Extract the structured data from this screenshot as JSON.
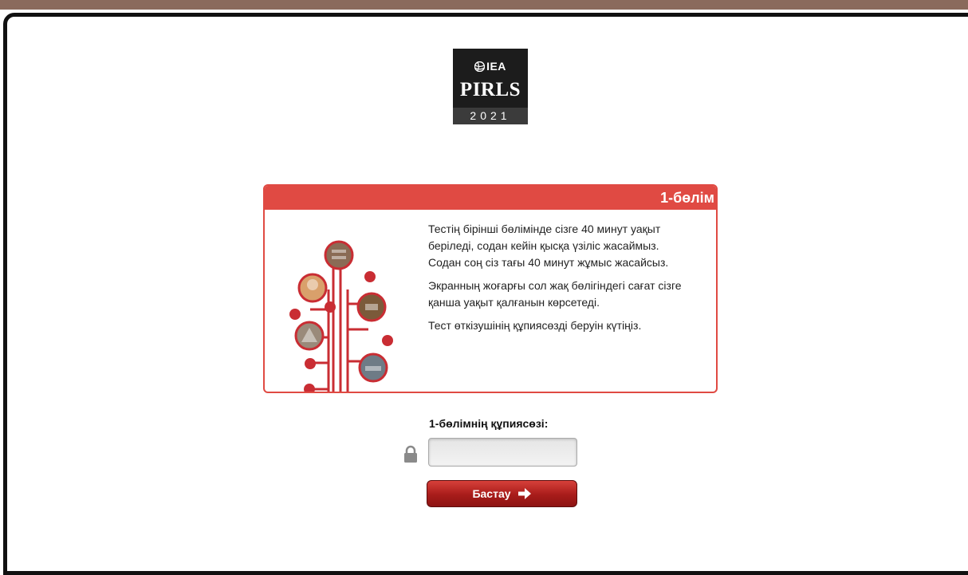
{
  "logo": {
    "org": "IEA",
    "name": "PIRLS",
    "year": "2021"
  },
  "section_card": {
    "header": "1-бөлім",
    "paragraphs": [
      "Тестің бірінші бөлімінде сізге 40 минут уақыт беріледі, содан кейін қысқа үзіліс жасаймыз. Содан соң сіз тағы 40 минут жұмыс жасайсыз.",
      "Экранның жоғарғы сол жақ бөлігіндегі сағат сізге қанша уақыт қалғанын көрсетеді.",
      "Тест өткізушінің құпиясөзді беруін күтіңіз."
    ]
  },
  "password": {
    "label": "1-бөлімнің құпиясөзі:",
    "value": "",
    "placeholder": ""
  },
  "start_button": {
    "label": "Бастау"
  },
  "colors": {
    "accent": "#e04a43",
    "button": "#a81c1a",
    "frame": "#111111"
  },
  "icons": {
    "lock": "lock-icon",
    "arrow": "arrow-right-icon",
    "iea": "iea-globe-icon"
  }
}
